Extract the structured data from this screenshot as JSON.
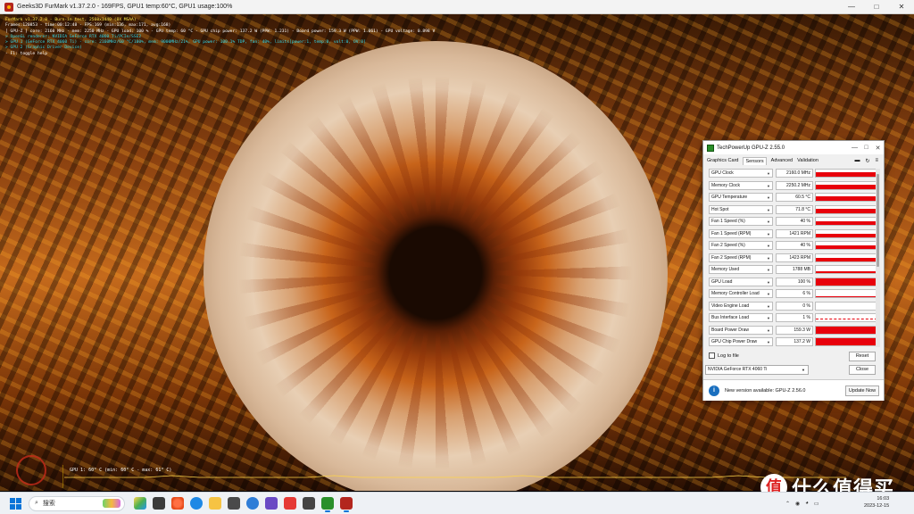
{
  "furmark": {
    "window_title": "Geeks3D FurMark v1.37.2.0 - 169FPS, GPU1 temp:60°C, GPU1 usage:100%",
    "osd_lines": [
      {
        "text": "FurMark v1.37.2.0 - Burn-in test, 2560x1440 (8X MSAA)",
        "color": "y"
      },
      {
        "text": "Frames:120853 - time:00:12:48 - FPS:169 (min:136, max:171, avg:168)",
        "color": "w"
      },
      {
        "text": "[ GPU-Z ] core: 2160 MHz - mem: 2250 MHz - GPU load: 100 % - GPU temp: 60 °C - GPU chip power: 137.2 W (PPW: 1.231) - Board power: 159.3 W (PPW: 1.061) - GPU voltage: 0.898 V",
        "color": "w"
      },
      {
        "text": "> OpenGL renderer: NVIDIA GeForce RTX 4060 Ti/PCIe/SSE2",
        "color": "c"
      },
      {
        "text": "> GPU 1 (GeForce RTX 4060 Ti) - core: 2160MHz/60 °C/100%, mem: 9000MHz/21%, GPU power: 100.1% TDP, fan: 40%, limits[power:1, temp:0, volt:0, OV:0]",
        "color": "c"
      },
      {
        "text": "> GPU 2 (Graphic Driver Device)",
        "color": "c"
      },
      {
        "text": "- F1: toggle help",
        "color": "w"
      }
    ],
    "graph_label": "GPU 1: 60° C (min: 60° C - max: 61° C)",
    "temp_readings": [
      60,
      60,
      60,
      60,
      61,
      60,
      60,
      60,
      60,
      60,
      61,
      60,
      60,
      60,
      60,
      60,
      60,
      61,
      60,
      60,
      60,
      60,
      60,
      60,
      60,
      61,
      60,
      60,
      60,
      60
    ]
  },
  "gpuz": {
    "title": "TechPowerUp GPU-Z 2.55.0",
    "tabs": [
      "Graphics Card",
      "Sensors",
      "Advanced",
      "Validation"
    ],
    "active_tab": "Sensors",
    "sensors": [
      {
        "name": "GPU Clock",
        "value": "2160.0 MHz",
        "level": 0.55
      },
      {
        "name": "Memory Clock",
        "value": "2250.2 MHz",
        "level": 0.55
      },
      {
        "name": "GPU Temperature",
        "value": "60.5 °C",
        "level": 0.6
      },
      {
        "name": "Hot Spot",
        "value": "71.8 °C",
        "level": 0.6
      },
      {
        "name": "Fan 1 Speed (%)",
        "value": "40 %",
        "level": 0.4
      },
      {
        "name": "Fan 1 Speed (RPM)",
        "value": "1421 RPM",
        "level": 0.4
      },
      {
        "name": "Fan 2 Speed (%)",
        "value": "40 %",
        "level": 0.4
      },
      {
        "name": "Fan 2 Speed (RPM)",
        "value": "1423 RPM",
        "level": 0.4
      },
      {
        "name": "Memory Used",
        "value": "1788 MB",
        "level": 0.22
      },
      {
        "name": "GPU Load",
        "value": "100 %",
        "level": 1.0
      },
      {
        "name": "Memory Controller Load",
        "value": "6 %",
        "level": 0.06
      },
      {
        "name": "Video Engine Load",
        "value": "0 %",
        "level": 0.0
      },
      {
        "name": "Bus Interface Load",
        "value": "1 %",
        "level": 0.01
      },
      {
        "name": "Board Power Draw",
        "value": "159.3 W",
        "level": 0.9
      },
      {
        "name": "GPU Chip Power Draw",
        "value": "137.2 W",
        "level": 0.9
      }
    ],
    "log_label": "Log to file",
    "reset_label": "Reset",
    "gpu_select": "NVIDIA GeForce RTX 4060 Ti",
    "close_label": "Close",
    "notice_text": "New version available: GPU-Z 2.56.0",
    "update_label": "Update Now"
  },
  "taskbar": {
    "search_placeholder": "搜索",
    "clock_time": "16:03",
    "clock_date": "2023-12-15"
  },
  "watermark": {
    "symbol": "值",
    "text": "什么值得买"
  },
  "colors": {
    "sensor_fill": "#e8000b",
    "osd_yellow": "#ffe94a",
    "osd_cyan": "#34d7e6",
    "accent": "#0a74d8"
  }
}
